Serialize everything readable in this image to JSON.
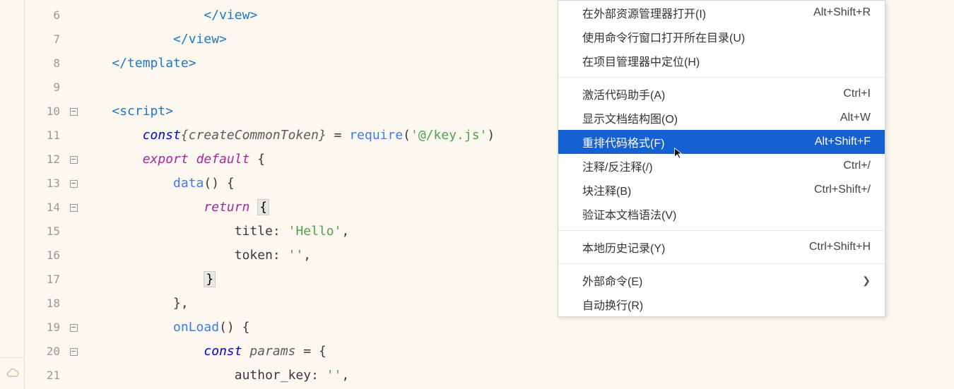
{
  "editor": {
    "lines": [
      {
        "num": "6",
        "fold": false,
        "tokens": [
          {
            "cls": "tag-angle",
            "t": "                </"
          },
          {
            "cls": "tag-name",
            "t": "view"
          },
          {
            "cls": "tag-angle",
            "t": ">"
          }
        ]
      },
      {
        "num": "7",
        "fold": false,
        "tokens": [
          {
            "cls": "tag-angle",
            "t": "            </"
          },
          {
            "cls": "tag-name",
            "t": "view"
          },
          {
            "cls": "tag-angle",
            "t": ">"
          }
        ]
      },
      {
        "num": "8",
        "fold": false,
        "tokens": [
          {
            "cls": "tag-angle",
            "t": "    </"
          },
          {
            "cls": "tag-name",
            "t": "template"
          },
          {
            "cls": "tag-angle",
            "t": ">"
          }
        ]
      },
      {
        "num": "9",
        "fold": false,
        "tokens": []
      },
      {
        "num": "10",
        "fold": true,
        "tokens": [
          {
            "cls": "tag-angle",
            "t": "    <"
          },
          {
            "cls": "tag-name",
            "t": "script"
          },
          {
            "cls": "tag-angle",
            "t": ">"
          }
        ]
      },
      {
        "num": "11",
        "fold": false,
        "tokens": [
          {
            "cls": "plain",
            "t": "        "
          },
          {
            "cls": "keyword-blue",
            "t": "const"
          },
          {
            "cls": "var-name",
            "t": "{createCommonToken}"
          },
          {
            "cls": "plain",
            "t": " = "
          },
          {
            "cls": "func-name",
            "t": "require"
          },
          {
            "cls": "plain",
            "t": "("
          },
          {
            "cls": "string",
            "t": "'@/key.js'"
          },
          {
            "cls": "plain",
            "t": ")"
          }
        ]
      },
      {
        "num": "12",
        "fold": true,
        "tokens": [
          {
            "cls": "plain",
            "t": "        "
          },
          {
            "cls": "keyword-purple",
            "t": "export"
          },
          {
            "cls": "plain",
            "t": " "
          },
          {
            "cls": "keyword-purple",
            "t": "default"
          },
          {
            "cls": "plain",
            "t": " {"
          }
        ]
      },
      {
        "num": "13",
        "fold": true,
        "tokens": [
          {
            "cls": "plain",
            "t": "            "
          },
          {
            "cls": "func-name",
            "t": "data"
          },
          {
            "cls": "plain",
            "t": "() {"
          }
        ]
      },
      {
        "num": "14",
        "fold": true,
        "tokens": [
          {
            "cls": "plain",
            "t": "                "
          },
          {
            "cls": "keyword-purple",
            "t": "return"
          },
          {
            "cls": "plain",
            "t": " "
          },
          {
            "cls": "curly-hl",
            "t": "{"
          }
        ]
      },
      {
        "num": "15",
        "fold": false,
        "tokens": [
          {
            "cls": "plain",
            "t": "                    title: "
          },
          {
            "cls": "string",
            "t": "'Hello'"
          },
          {
            "cls": "plain",
            "t": ","
          }
        ]
      },
      {
        "num": "16",
        "fold": false,
        "tokens": [
          {
            "cls": "plain",
            "t": "                    token: "
          },
          {
            "cls": "string",
            "t": "''"
          },
          {
            "cls": "plain",
            "t": ","
          }
        ]
      },
      {
        "num": "17",
        "fold": false,
        "tokens": [
          {
            "cls": "plain",
            "t": "                "
          },
          {
            "cls": "curly-hl",
            "t": "}"
          }
        ]
      },
      {
        "num": "18",
        "fold": false,
        "tokens": [
          {
            "cls": "plain",
            "t": "            },"
          }
        ]
      },
      {
        "num": "19",
        "fold": true,
        "tokens": [
          {
            "cls": "plain",
            "t": "            "
          },
          {
            "cls": "func-name",
            "t": "onLoad"
          },
          {
            "cls": "plain",
            "t": "() {"
          }
        ]
      },
      {
        "num": "20",
        "fold": true,
        "tokens": [
          {
            "cls": "plain",
            "t": "                "
          },
          {
            "cls": "keyword-blue",
            "t": "const"
          },
          {
            "cls": "plain",
            "t": " "
          },
          {
            "cls": "var-name",
            "t": "params"
          },
          {
            "cls": "plain",
            "t": " = {"
          }
        ]
      },
      {
        "num": "21",
        "fold": false,
        "tokens": [
          {
            "cls": "plain",
            "t": "                    author_key: "
          },
          {
            "cls": "string",
            "t": "''"
          },
          {
            "cls": "plain",
            "t": ","
          }
        ]
      }
    ]
  },
  "menu": {
    "groups": [
      [
        {
          "label": "在外部资源管理器打开(I)",
          "shortcut": "Alt+Shift+R",
          "sub": false,
          "hl": false
        },
        {
          "label": "使用命令行窗口打开所在目录(U)",
          "shortcut": "",
          "sub": false,
          "hl": false
        },
        {
          "label": "在项目管理器中定位(H)",
          "shortcut": "",
          "sub": false,
          "hl": false
        }
      ],
      [
        {
          "label": "激活代码助手(A)",
          "shortcut": "Ctrl+I",
          "sub": false,
          "hl": false
        },
        {
          "label": "显示文档结构图(O)",
          "shortcut": "Alt+W",
          "sub": false,
          "hl": false
        },
        {
          "label": "重排代码格式(F)",
          "shortcut": "Alt+Shift+F",
          "sub": false,
          "hl": true
        },
        {
          "label": "注释/反注释(/)",
          "shortcut": "Ctrl+/",
          "sub": false,
          "hl": false
        },
        {
          "label": "块注释(B)",
          "shortcut": "Ctrl+Shift+/",
          "sub": false,
          "hl": false
        },
        {
          "label": "验证本文档语法(V)",
          "shortcut": "",
          "sub": false,
          "hl": false
        }
      ],
      [
        {
          "label": "本地历史记录(Y)",
          "shortcut": "Ctrl+Shift+H",
          "sub": false,
          "hl": false
        }
      ],
      [
        {
          "label": "外部命令(E)",
          "shortcut": "",
          "sub": true,
          "hl": false
        },
        {
          "label": "自动换行(R)",
          "shortcut": "",
          "sub": false,
          "hl": false
        }
      ]
    ]
  }
}
